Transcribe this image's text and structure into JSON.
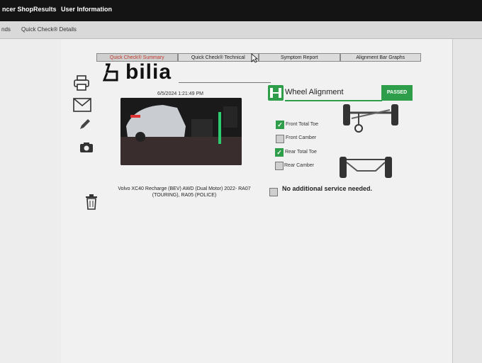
{
  "topbar": {
    "item_shopresults": "ncer ShopResults",
    "item_userinfo": "User Information"
  },
  "subbar": {
    "item_left": "nds",
    "item_details": "Quick Check® Details"
  },
  "tabs": [
    "Quick Check® Summary",
    "Quick Check® Technical",
    "Symptom Report",
    "Alignment Bar Graphs"
  ],
  "brand": {
    "logo": "bilia"
  },
  "report": {
    "date": "6/5/2024 1:21:49 PM",
    "vehicle": "Volvo XC40 Recharge (BEV) AWD (Dual Motor) 2022- RA07 (TOURING), RA05 (POLICE)"
  },
  "alignment": {
    "title": "Wheel Alignment",
    "status": "PASSED",
    "checks": [
      {
        "label": "Front Total Toe",
        "checked": true
      },
      {
        "label": "Front Camber",
        "checked": false
      },
      {
        "label": "Rear Total Toe",
        "checked": true
      },
      {
        "label": "Rear Camber",
        "checked": false
      }
    ],
    "service_note": "No additional service needed.",
    "service_checked": false
  },
  "icons": [
    "printer-icon",
    "envelope-icon",
    "pencil-icon",
    "camera-icon",
    "trash-icon",
    "wheel-alignment-icon",
    "front-axle-diagram-icon",
    "rear-axle-diagram-icon",
    "mouse-cursor-icon"
  ],
  "colors": {
    "pass_green": "#2e9e4a",
    "active_tab_red": "#c0392b",
    "topbar": "#141414"
  }
}
